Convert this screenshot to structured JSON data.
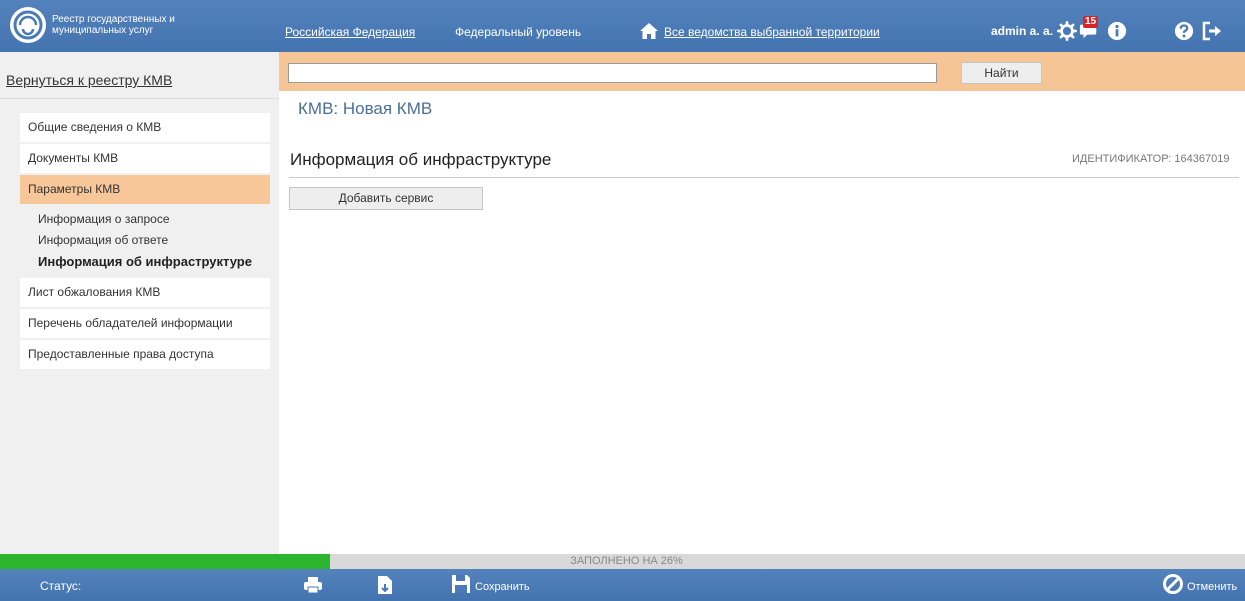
{
  "header": {
    "logo_text": "Реестр государственных и муниципальных услуг",
    "region_link": "Российская Федерация",
    "level_link": "Федеральный уровень",
    "departments_link": "Все ведомства выбранной территории",
    "user_name": "admin a. a.",
    "notifications_count": "15"
  },
  "sidebar": {
    "back_link": "Вернуться к реестру КМВ",
    "items": [
      {
        "label": "Общие сведения о КМВ"
      },
      {
        "label": "Документы КМВ"
      },
      {
        "label": "Параметры КМВ"
      },
      {
        "label": "Лист обжалования КМВ"
      },
      {
        "label": "Перечень обладателей информации"
      },
      {
        "label": "Предоставленные права доступа"
      }
    ],
    "sub_items": [
      {
        "label": "Информация о запросе"
      },
      {
        "label": "Информация об ответе"
      },
      {
        "label": "Информация об инфраструктуре"
      }
    ]
  },
  "search": {
    "value": "",
    "button_label": "Найти"
  },
  "main": {
    "page_title": "КМВ: Новая КМВ",
    "section_title": "Информация об инфраструктуре",
    "identifier": "ИДЕНТИФИКАТОР: 164367019",
    "add_service_label": "Добавить сервис"
  },
  "progress": {
    "label": "ЗАПОЛНЕНО НА 26%",
    "fraction": 0.26
  },
  "footer": {
    "status_label": "Статус:",
    "save_label": "Сохранить",
    "cancel_label": "Отменить"
  },
  "colors": {
    "header_blue": "#4a7bb7",
    "accent_orange": "#f6c596",
    "progress_green": "#2db52d",
    "badge_red": "#d7262b"
  },
  "icons": [
    "logo-icon",
    "home-icon",
    "gear-icon",
    "messages-icon",
    "info-icon",
    "help-icon",
    "logout-icon",
    "print-icon",
    "export-icon",
    "save-icon",
    "cancel-icon"
  ]
}
